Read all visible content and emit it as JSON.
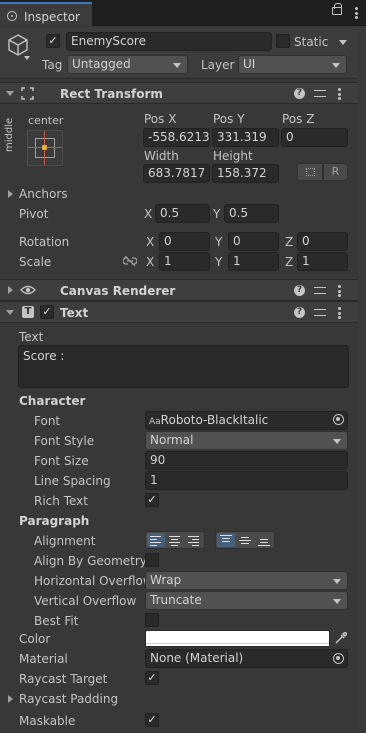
{
  "tab": {
    "title": "Inspector"
  },
  "object": {
    "active": true,
    "name": "EnemyScore",
    "static_label": "Static",
    "static": false,
    "tag_label": "Tag",
    "tag_value": "Untagged",
    "layer_label": "Layer",
    "layer_value": "UI"
  },
  "rect_transform": {
    "title": "Rect Transform",
    "anchor_h": "center",
    "anchor_v": "middle",
    "pos_x_label": "Pos X",
    "pos_x": "-558.6213",
    "pos_y_label": "Pos Y",
    "pos_y": "331.319",
    "pos_z_label": "Pos Z",
    "pos_z": "0",
    "width_label": "Width",
    "width": "683.7817",
    "height_label": "Height",
    "height": "158.372",
    "r_button": "R",
    "anchors_label": "Anchors",
    "pivot_label": "Pivot",
    "pivot": {
      "x": "0.5",
      "y": "0.5"
    },
    "rotation_label": "Rotation",
    "rotation": {
      "x": "0",
      "y": "0",
      "z": "0"
    },
    "scale_label": "Scale",
    "scale": {
      "x": "1",
      "y": "1",
      "z": "1"
    },
    "axis": {
      "x": "X",
      "y": "Y",
      "z": "Z"
    }
  },
  "canvas_renderer": {
    "title": "Canvas Renderer"
  },
  "text": {
    "title": "Text",
    "enabled": true,
    "text_label": "Text",
    "text_value": "Score :",
    "character_label": "Character",
    "font_label": "Font",
    "font_value": "Roboto-BlackItalic",
    "font_icon": "Aa",
    "font_style_label": "Font Style",
    "font_style_value": "Normal",
    "font_size_label": "Font Size",
    "font_size_value": "90",
    "line_spacing_label": "Line Spacing",
    "line_spacing_value": "1",
    "rich_text_label": "Rich Text",
    "rich_text": true,
    "paragraph_label": "Paragraph",
    "alignment_label": "Alignment",
    "align_by_geometry_label": "Align By Geometry",
    "align_by_geometry": false,
    "h_overflow_label": "Horizontal Overflow",
    "h_overflow_value": "Wrap",
    "v_overflow_label": "Vertical Overflow",
    "v_overflow_value": "Truncate",
    "best_fit_label": "Best Fit",
    "best_fit": false,
    "color_label": "Color",
    "color_value": "#ffffff",
    "material_label": "Material",
    "material_value": "None (Material)",
    "raycast_target_label": "Raycast Target",
    "raycast_target": true,
    "raycast_padding_label": "Raycast Padding",
    "maskable_label": "Maskable",
    "maskable": true
  },
  "colors": {
    "panel": "#383838",
    "header": "#3e3e3e",
    "field": "#2a2a2a",
    "accent": "#3a79bb",
    "active_align": "#46607c"
  }
}
